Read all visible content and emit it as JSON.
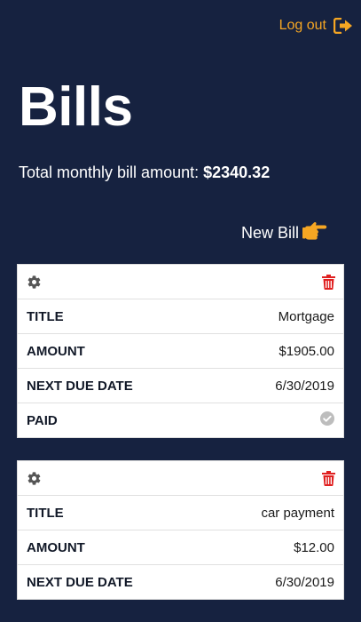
{
  "header": {
    "logout_label": "Log out",
    "logout_icon": "sign-out-icon"
  },
  "page": {
    "title": "Bills",
    "total_label": "Total monthly bill amount:",
    "total_value": "$2340.32",
    "new_bill_label": "New Bill",
    "new_bill_icon": "hand-pointing-right-icon"
  },
  "colors": {
    "background": "#162240",
    "accent": "#f5a623",
    "delete": "#e02020",
    "gear": "#555555",
    "check": "#bdbdbd"
  },
  "bills": [
    {
      "rows": [
        {
          "label": "Title",
          "value": "Mortgage"
        },
        {
          "label": "Amount",
          "value": "$1905.00"
        },
        {
          "label": "Next due date",
          "value": "6/30/2019"
        },
        {
          "label": "Paid",
          "value": "",
          "icon": "check-circle-icon"
        }
      ]
    },
    {
      "rows": [
        {
          "label": "Title",
          "value": "car payment"
        },
        {
          "label": "Amount",
          "value": "$12.00"
        },
        {
          "label": "Next due date",
          "value": "6/30/2019"
        }
      ]
    }
  ]
}
